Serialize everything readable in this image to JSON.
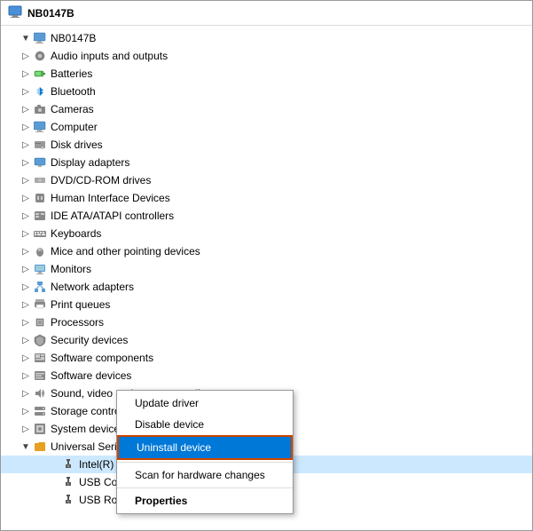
{
  "title": "NB0147B",
  "tree": {
    "root_label": "NB0147B",
    "items": [
      {
        "id": "audio",
        "label": "Audio inputs and outputs",
        "icon": "audio",
        "level": 1,
        "expanded": false
      },
      {
        "id": "batteries",
        "label": "Batteries",
        "icon": "battery",
        "level": 1,
        "expanded": false
      },
      {
        "id": "bluetooth",
        "label": "Bluetooth",
        "icon": "bluetooth",
        "level": 1,
        "expanded": false
      },
      {
        "id": "cameras",
        "label": "Cameras",
        "icon": "camera",
        "level": 1,
        "expanded": false
      },
      {
        "id": "computer",
        "label": "Computer",
        "icon": "computer",
        "level": 1,
        "expanded": false
      },
      {
        "id": "disk",
        "label": "Disk drives",
        "icon": "disk",
        "level": 1,
        "expanded": false
      },
      {
        "id": "display",
        "label": "Display adapters",
        "icon": "display",
        "level": 1,
        "expanded": false
      },
      {
        "id": "dvd",
        "label": "DVD/CD-ROM drives",
        "icon": "dvd",
        "level": 1,
        "expanded": false
      },
      {
        "id": "hid",
        "label": "Human Interface Devices",
        "icon": "hid",
        "level": 1,
        "expanded": false
      },
      {
        "id": "ide",
        "label": "IDE ATA/ATAPI controllers",
        "icon": "ide",
        "level": 1,
        "expanded": false
      },
      {
        "id": "keyboards",
        "label": "Keyboards",
        "icon": "keyboard",
        "level": 1,
        "expanded": false
      },
      {
        "id": "mice",
        "label": "Mice and other pointing devices",
        "icon": "mouse",
        "level": 1,
        "expanded": false
      },
      {
        "id": "monitors",
        "label": "Monitors",
        "icon": "monitor",
        "level": 1,
        "expanded": false
      },
      {
        "id": "network",
        "label": "Network adapters",
        "icon": "network",
        "level": 1,
        "expanded": false
      },
      {
        "id": "print",
        "label": "Print queues",
        "icon": "printer",
        "level": 1,
        "expanded": false
      },
      {
        "id": "processors",
        "label": "Processors",
        "icon": "processor",
        "level": 1,
        "expanded": false
      },
      {
        "id": "security",
        "label": "Security devices",
        "icon": "security",
        "level": 1,
        "expanded": false
      },
      {
        "id": "softcomp",
        "label": "Software components",
        "icon": "softcomp",
        "level": 1,
        "expanded": false
      },
      {
        "id": "softdev",
        "label": "Software devices",
        "icon": "softdev",
        "level": 1,
        "expanded": false
      },
      {
        "id": "sound",
        "label": "Sound, video and game controllers",
        "icon": "sound",
        "level": 1,
        "expanded": false
      },
      {
        "id": "storage",
        "label": "Storage controllers",
        "icon": "storage",
        "level": 1,
        "expanded": false
      },
      {
        "id": "sysdev",
        "label": "System devices",
        "icon": "sysdev",
        "level": 1,
        "expanded": false
      },
      {
        "id": "usb",
        "label": "Universal Serial Bus controllers",
        "icon": "usb",
        "level": 1,
        "expanded": true
      },
      {
        "id": "intel_usb",
        "label": "Intel(R) U...           ...osoft)",
        "icon": "usb_device",
        "level": 2,
        "expanded": false,
        "selected": true
      },
      {
        "id": "usb_com",
        "label": "USB Com...",
        "icon": "usb_device",
        "level": 2,
        "expanded": false
      },
      {
        "id": "usb_root",
        "label": "USB Roo...",
        "icon": "usb_device",
        "level": 2,
        "expanded": false
      }
    ]
  },
  "context_menu": {
    "items": [
      {
        "id": "update",
        "label": "Update driver",
        "bold": false,
        "highlighted": false
      },
      {
        "id": "disable",
        "label": "Disable device",
        "bold": false,
        "highlighted": false
      },
      {
        "id": "uninstall",
        "label": "Uninstall device",
        "bold": false,
        "highlighted": true
      },
      {
        "id": "scan",
        "label": "Scan for hardware changes",
        "bold": false,
        "highlighted": false
      },
      {
        "id": "properties",
        "label": "Properties",
        "bold": true,
        "highlighted": false
      }
    ]
  }
}
